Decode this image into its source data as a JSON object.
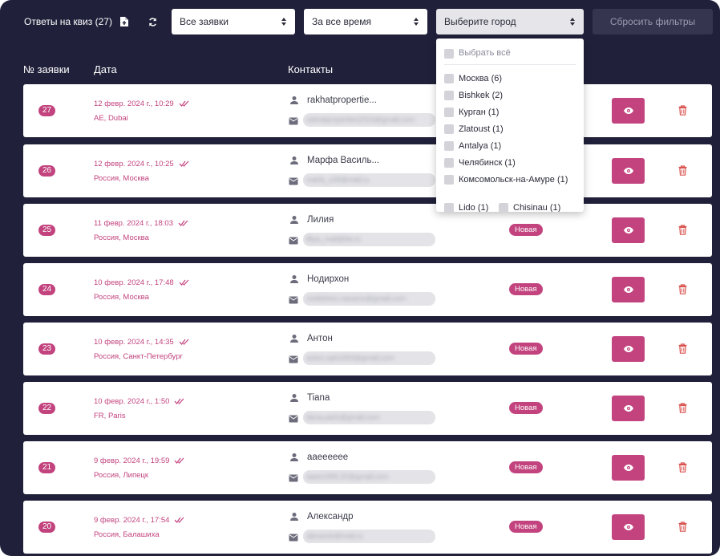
{
  "header": {
    "title": "Ответы на квиз (27)",
    "status_select": "Все заявки",
    "period_select": "За все время",
    "city_select": "Выберите город",
    "reset_label": "Сбросить фильтры"
  },
  "columns": {
    "number": "№ заявки",
    "date": "Дата",
    "contacts": "Контакты"
  },
  "city_dropdown": {
    "select_all": "Выбрать всё",
    "items": [
      "Москва (6)",
      "Bishkek (2)",
      "Курган (1)",
      "Zlatoust (1)",
      "Antalya (1)",
      "Челябинск (1)",
      "Комсомольск-на-Амуре (1)"
    ],
    "partial_items": [
      "Lido (1)",
      "Chisinau (1)"
    ]
  },
  "rows": [
    {
      "id": "27",
      "date": "12 февр. 2024 г., 10:29",
      "location": "AE, Dubai",
      "name": "rakhatpropertie...",
      "email": "rakhatproperties2024@gmail.com",
      "status": ""
    },
    {
      "id": "26",
      "date": "12 февр. 2024 г., 10:25",
      "location": "Россия, Москва",
      "name": "Марфа Василь...",
      "email": "marfa_v28@mail.ru",
      "status": ""
    },
    {
      "id": "25",
      "date": "11 февр. 2024 г., 18:03",
      "location": "Россия, Москва",
      "name": "Лилия",
      "email": "liliya_mail@bk.ru",
      "status": "Новая"
    },
    {
      "id": "24",
      "date": "10 февр. 2024 г., 17:48",
      "location": "Россия, Москва",
      "name": "Нодирхон",
      "email": "nodirkhon.nazarov@gmail.com",
      "status": "Новая"
    },
    {
      "id": "23",
      "date": "10 февр. 2024 г., 14:35",
      "location": "Россия, Санкт-Петербург",
      "name": "Антон",
      "email": "anton.spb1993@gmail.com",
      "status": "Новая"
    },
    {
      "id": "22",
      "date": "10 февр. 2024 г., 1:50",
      "location": "FR, Paris",
      "name": "Tiana",
      "email": "tiana.paris@gmail.com",
      "status": "Новая"
    },
    {
      "id": "21",
      "date": "9 февр. 2024 г., 19:59",
      "location": "Россия, Липецк",
      "name": "aaeeeeee",
      "email": "aaee1996.20@gmail.com",
      "status": "Новая"
    },
    {
      "id": "20",
      "date": "9 февр. 2024 г., 17:54",
      "location": "Россия, Балашиха",
      "name": "Александр",
      "email": "alexandr@mail.ru",
      "status": "Новая"
    }
  ],
  "colors": {
    "background": "#20203a",
    "accent": "#c2437e",
    "delete": "#d9534f"
  }
}
